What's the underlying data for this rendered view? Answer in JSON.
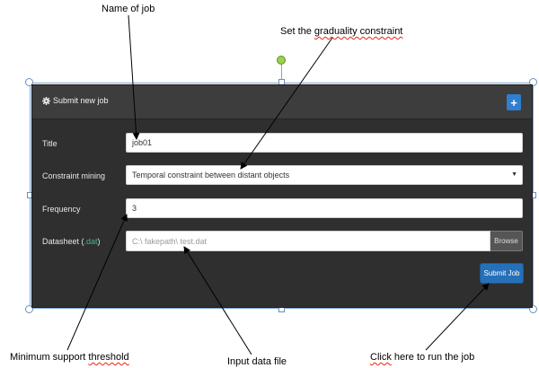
{
  "annotations": {
    "name_of_job": "Name of job",
    "gradual_constraint_prefix": "Set the ",
    "gradual_constraint_word": "graduality constraint",
    "min_support": "Minimum support ",
    "min_support_word": "threshold",
    "input_file": "Input data file",
    "run_job_word": "Click",
    "run_job_rest": "  here to run the job"
  },
  "panel": {
    "title": "Submit new job",
    "add_label": "+",
    "title_label": "Title",
    "title_value": "job01",
    "constraint_label": "Constraint mining",
    "constraint_value": "Temporal constraint between distant objects",
    "frequency_label": "Frequency",
    "frequency_value": "3",
    "datasheet_label": "Datasheet (",
    "datasheet_ext": ".dat",
    "datasheet_close": ")",
    "file_placeholder": "C:\\ fakepath\\ test.dat",
    "browse_label": "Browse",
    "submit_label": "Submit Job"
  },
  "icons": {
    "header_icon": "gear-icon",
    "select_caret": "caret-down-icon"
  },
  "colors": {
    "panel_bg": "#2f2f2f",
    "header_bg": "#3d3d3d",
    "accent_blue": "#2670b8",
    "extension_green": "#3fb89a"
  }
}
